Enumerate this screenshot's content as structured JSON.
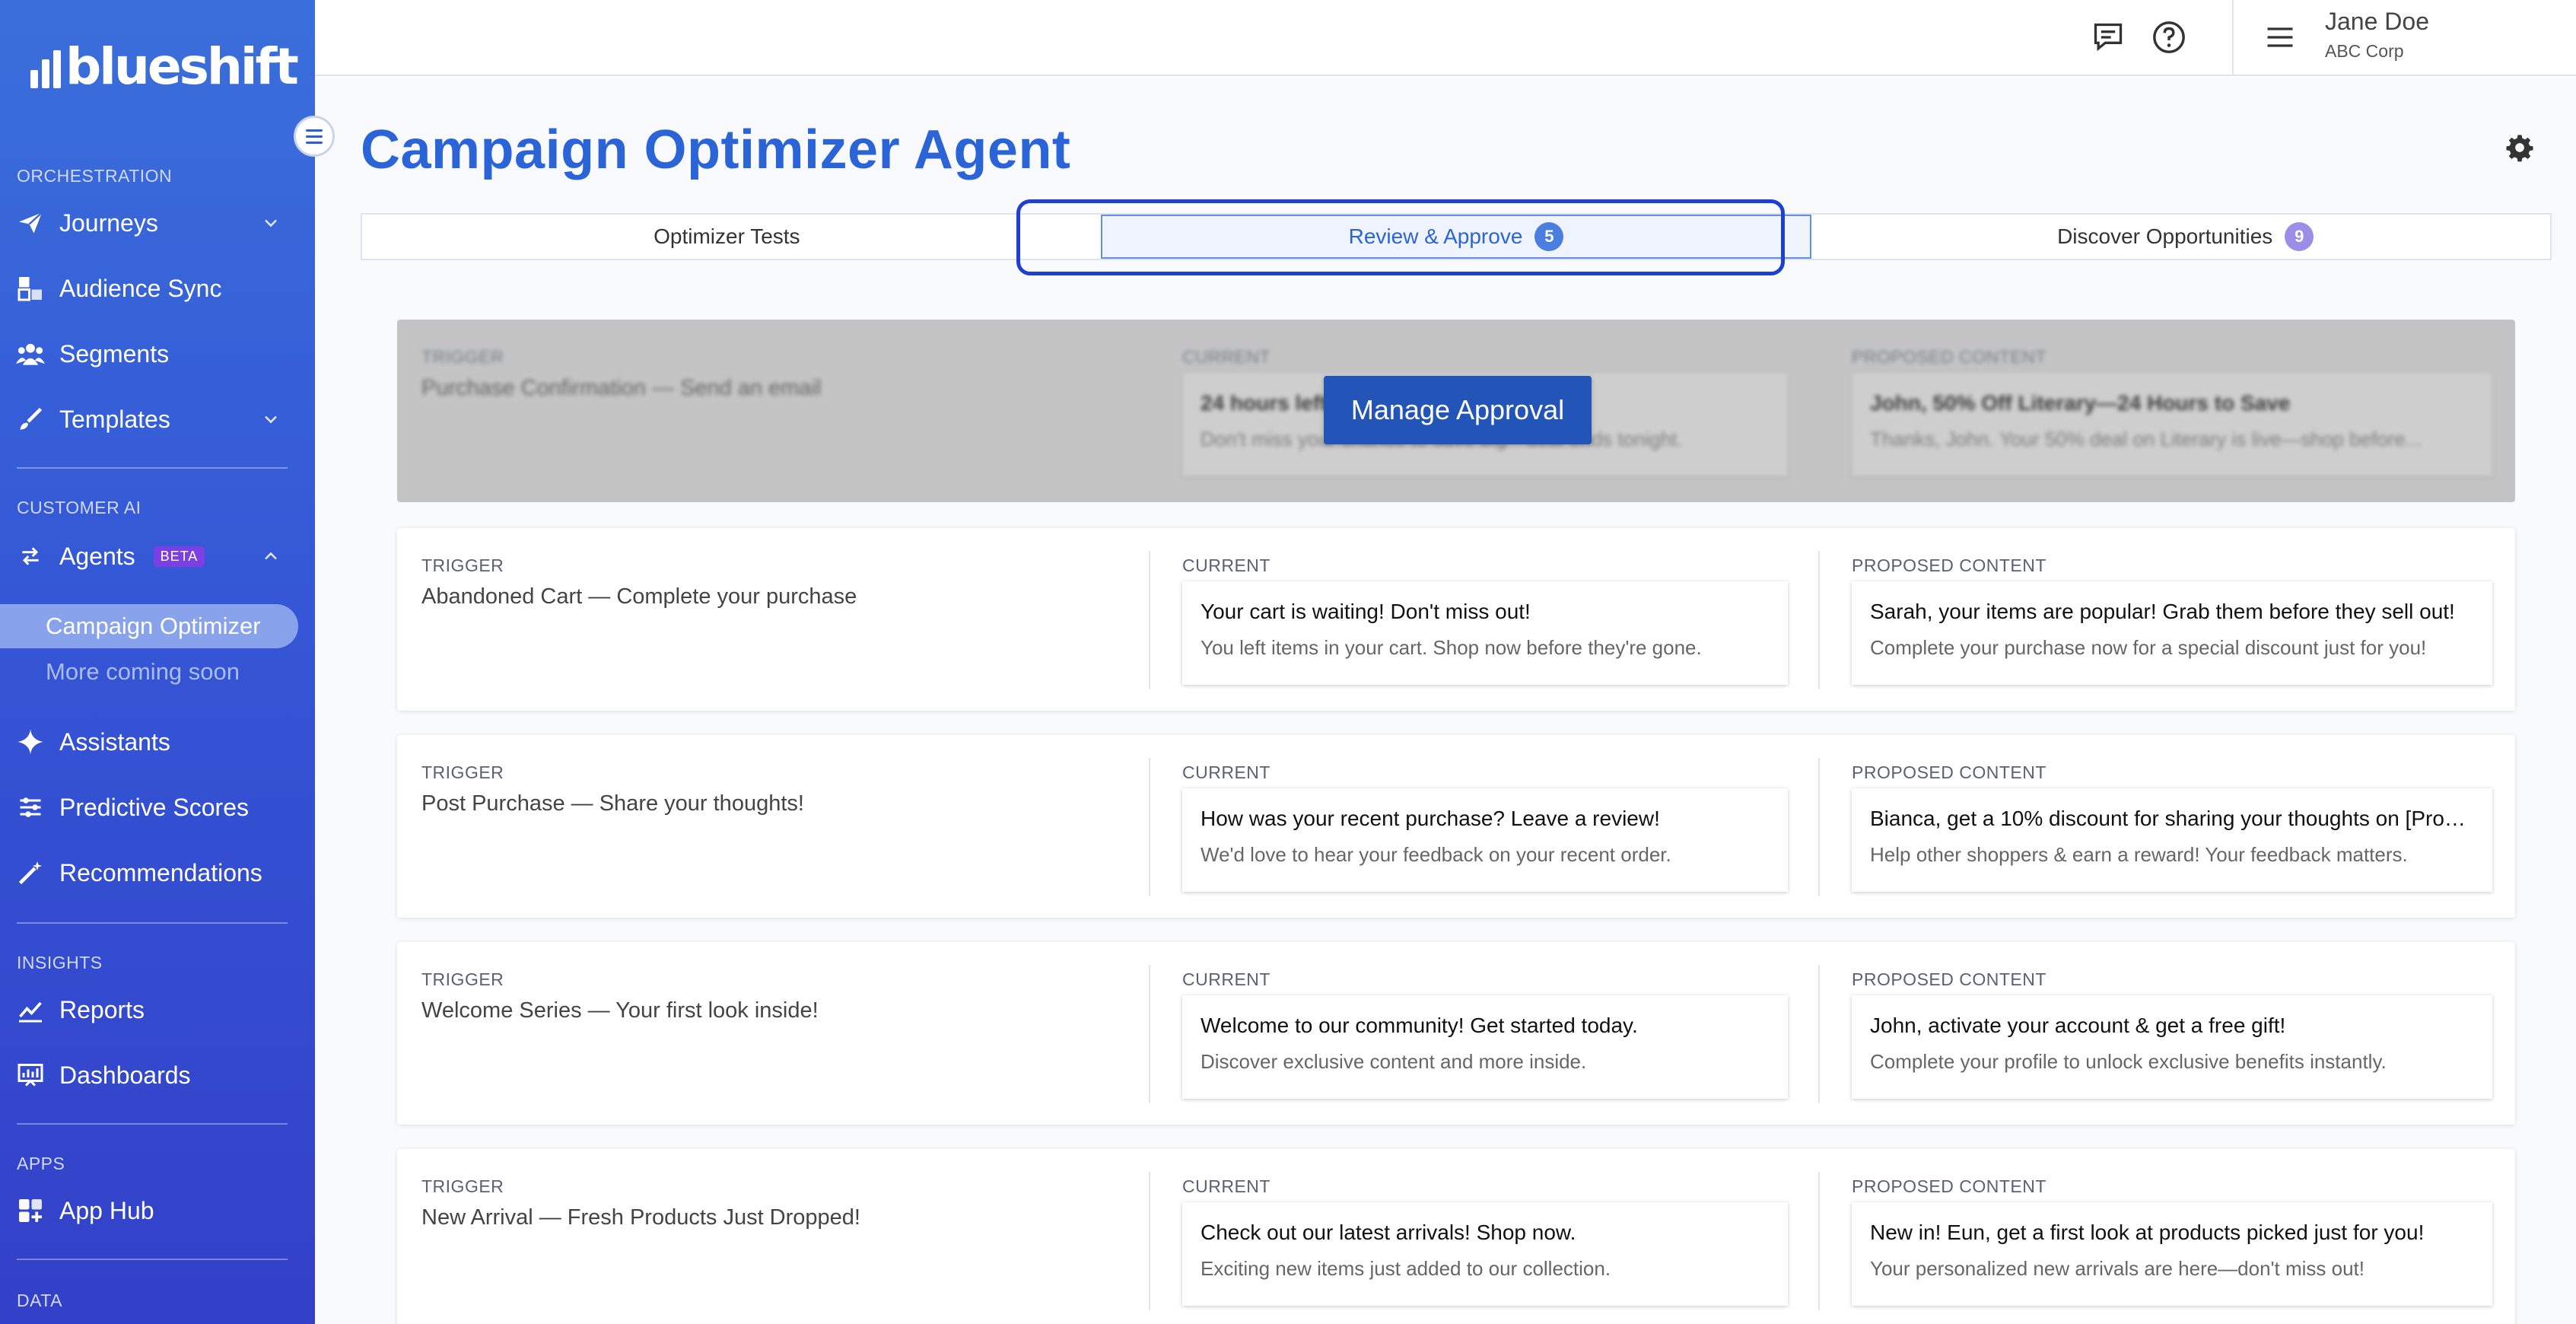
{
  "brand": {
    "name": "blueshift"
  },
  "sidebar": {
    "sections": [
      {
        "label": "ORCHESTRATION"
      },
      {
        "label": "CUSTOMER AI"
      },
      {
        "label": "INSIGHTS"
      },
      {
        "label": "APPS"
      },
      {
        "label": "DATA"
      }
    ],
    "items": {
      "journeys": "Journeys",
      "audience_sync": "Audience Sync",
      "segments": "Segments",
      "templates": "Templates",
      "agents": "Agents",
      "agents_badge": "BETA",
      "campaign_optimizer": "Campaign Optimizer",
      "more_coming": "More coming soon",
      "assistants": "Assistants",
      "predictive_scores": "Predictive Scores",
      "recommendations": "Recommendations",
      "reports": "Reports",
      "dashboards": "Dashboards",
      "app_hub": "App Hub"
    }
  },
  "header": {
    "user_name": "Jane Doe",
    "user_org": "ABC Corp",
    "icons": [
      "chat-icon",
      "help-icon",
      "menu-icon"
    ]
  },
  "page": {
    "title": "Campaign Optimizer Agent",
    "tabs": [
      {
        "label": "Optimizer Tests",
        "count": null
      },
      {
        "label": "Review & Approve",
        "count": "5",
        "count_color": "#4a7fe0"
      },
      {
        "label": "Discover Opportunities",
        "count": "9",
        "count_color": "#9b8de8"
      }
    ],
    "manage_button": "Manage Approval",
    "columns": {
      "trigger": "TRIGGER",
      "current": "CURRENT",
      "proposed": "PROPOSED CONTENT"
    },
    "cards": [
      {
        "trigger": "Purchase Confirmation — Send an email",
        "current_subject": "24 hours left...",
        "current_preview": "Don't miss your chance to save big—deal ends tonight.",
        "proposed_subject": "John, 50% Off Literary—24 Hours to Save",
        "proposed_preview": "Thanks, John. Your 50% deal on Literary is live—shop before..."
      },
      {
        "trigger": "Abandoned Cart — Complete your purchase",
        "current_subject": "Your cart is waiting! Don't miss out!",
        "current_preview": "You left items in your cart. Shop now before they're gone.",
        "proposed_subject": "Sarah, your items are popular! Grab them before they sell out!",
        "proposed_preview": "Complete your purchase now for a special discount just for you!"
      },
      {
        "trigger": "Post Purchase — Share your thoughts!",
        "current_subject": "How was your recent purchase? Leave a review!",
        "current_preview": "We'd love to hear your feedback on your recent order.",
        "proposed_subject": "Bianca, get a 10% discount for sharing your thoughts on [Produ...",
        "proposed_preview": "Help other shoppers & earn a reward! Your feedback matters."
      },
      {
        "trigger": "Welcome Series — Your first look inside!",
        "current_subject": "Welcome to our community! Get started today.",
        "current_preview": "Discover exclusive content and more inside.",
        "proposed_subject": "John, activate your account & get a free gift!",
        "proposed_preview": "Complete your profile to unlock exclusive benefits instantly."
      },
      {
        "trigger": "New Arrival — Fresh Products Just Dropped!",
        "current_subject": "Check out our latest arrivals! Shop now.",
        "current_preview": "Exciting new items just added to our collection.",
        "proposed_subject": "New in! Eun, get a first look at products picked just for you!",
        "proposed_preview": "Your personalized new arrivals are here—don't miss out!"
      }
    ]
  },
  "colors": {
    "accent": "#2b64d6",
    "highlight": "#1f3fd1",
    "arrow": "#1f3fd1"
  }
}
